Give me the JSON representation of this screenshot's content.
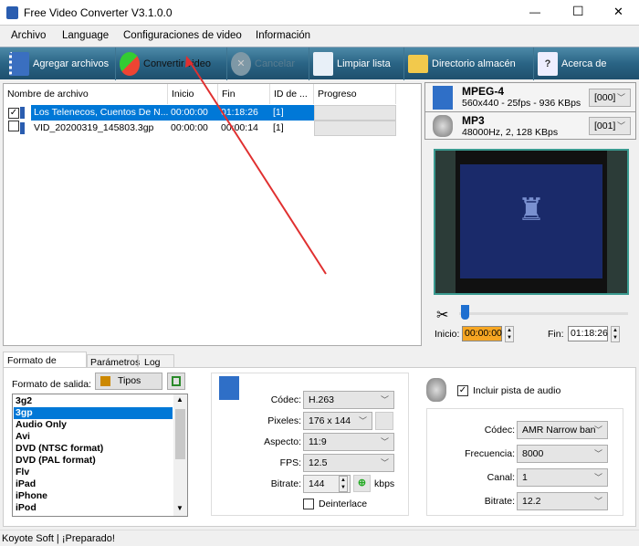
{
  "window": {
    "title": "Free Video Converter V3.1.0.0",
    "minimize": "—",
    "maximize": "☐",
    "close": "✕"
  },
  "menu": [
    "Archivo",
    "Language",
    "Configuraciones de video",
    "Información"
  ],
  "toolbar": {
    "add": "Agregar archivos",
    "convert": "Convertir video",
    "cancel": "Cancelar",
    "clear": "Limpiar lista",
    "dir": "Directorio almacén",
    "about": "Acerca de"
  },
  "filelist": {
    "headers": [
      "Nombre de archivo",
      "Inicio",
      "Fin",
      "ID de ...",
      "Progreso"
    ],
    "rows": [
      {
        "checked": "✓",
        "name": "Los Telenecos, Cuentos De N...",
        "start": "00:00:00",
        "end": "01:18:26",
        "id": "[1]"
      },
      {
        "checked": "",
        "name": "VID_20200319_145803.3gp",
        "start": "00:00:00",
        "end": "00:00:14",
        "id": "[1]"
      }
    ]
  },
  "streams": {
    "video": {
      "name": "MPEG-4",
      "info": "560x440 - 25fps - 936 KBps",
      "track": "[000]"
    },
    "audio": {
      "name": "MP3",
      "info": "48000Hz, 2, 128 KBps",
      "track": "[001]"
    }
  },
  "trim": {
    "start_label": "Inicio:",
    "start": "00:00:00",
    "end_label": "Fin:",
    "end": "01:18:26",
    "position": 0
  },
  "tabs": [
    "Formato de salida",
    "Parámetros",
    "Log"
  ],
  "output": {
    "label": "Formato de salida:",
    "types_button": "Tipos",
    "formats": [
      "3g2",
      "3gp",
      "Audio Only",
      "Avi",
      "DVD (NTSC format)",
      "DVD (PAL format)",
      "Flv",
      "iPad",
      "iPhone",
      "iPod"
    ],
    "selected": "3gp"
  },
  "video_settings": {
    "codec_label": "Códec:",
    "codec": "H.263",
    "pixels_label": "Pixeles:",
    "pixels": "176 x 144",
    "aspect_label": "Aspecto:",
    "aspect": "11:9",
    "fps_label": "FPS:",
    "fps": "12.5",
    "bitrate_label": "Bitrate:",
    "bitrate": "144",
    "bitrate_unit": "kbps",
    "deinterlace": "Deinterlace"
  },
  "audio_settings": {
    "include": "Incluir pista de audio",
    "codec_label": "Códec:",
    "codec": "AMR Narrow ban",
    "freq_label": "Frecuencia:",
    "freq": "8000",
    "channel_label": "Canal:",
    "channel": "1",
    "bitrate_label": "Bitrate:",
    "bitrate": "12.2"
  },
  "status": {
    "company": "Koyote Soft",
    "message": "¡Preparado!"
  }
}
